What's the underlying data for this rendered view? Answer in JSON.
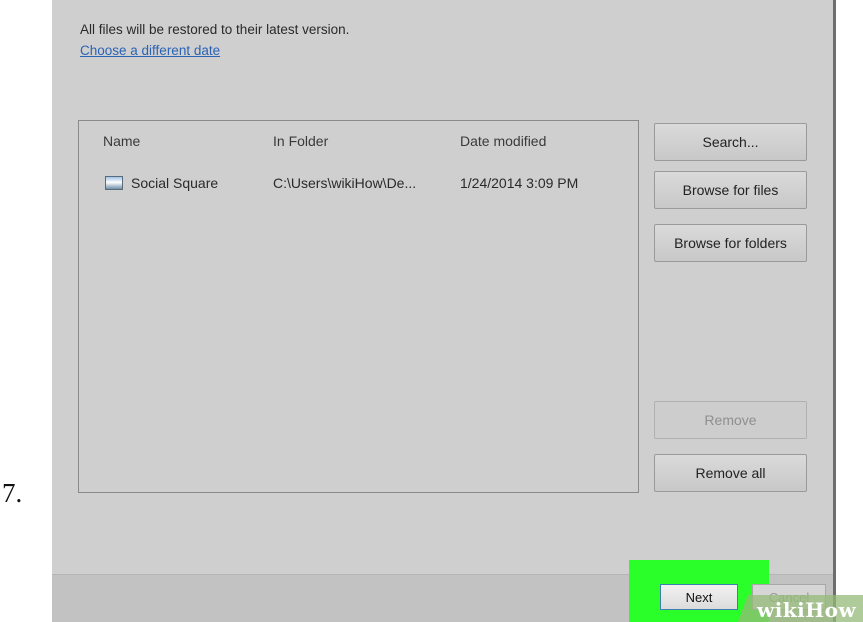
{
  "step": {
    "number": "7."
  },
  "dialog": {
    "intro_text": "All files will be restored to their latest version.",
    "date_link": "Choose a different date"
  },
  "file_list": {
    "columns": {
      "name": "Name",
      "folder": "In Folder",
      "date": "Date modified"
    },
    "rows": [
      {
        "icon": "image-file-icon",
        "name": "Social Square",
        "folder": "C:\\Users\\wikiHow\\De...",
        "date": "1/24/2014 3:09 PM"
      }
    ]
  },
  "buttons": {
    "search": "Search...",
    "browse_files": "Browse for files",
    "browse_folders": "Browse for folders",
    "remove": "Remove",
    "remove_all": "Remove all",
    "next": "Next",
    "cancel": "Cancel"
  },
  "watermark": {
    "text": "wikiHow"
  },
  "colors": {
    "highlight": "#2aff2a",
    "link": "#2b63b5",
    "dialog_bg": "#cfcfcf"
  }
}
